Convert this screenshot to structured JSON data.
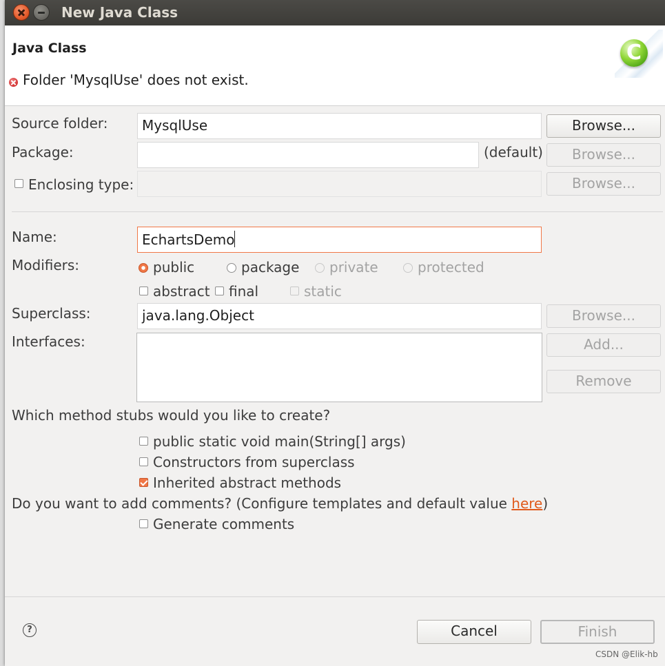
{
  "window": {
    "title": "New Java Class"
  },
  "header": {
    "title": "Java Class",
    "message": "Folder 'MysqlUse' does not exist."
  },
  "source_folder": {
    "label": "Source folder:",
    "value": "MysqlUse",
    "browse": "Browse..."
  },
  "package": {
    "label": "Package:",
    "value": "",
    "default_label": "(default)",
    "browse": "Browse..."
  },
  "enclosing": {
    "label": "Enclosing type:",
    "value": "",
    "browse": "Browse..."
  },
  "name": {
    "label": "Name:",
    "value": "EchartsDemo"
  },
  "modifiers": {
    "label": "Modifiers:",
    "public": "public",
    "package": "package",
    "private": "private",
    "protected": "protected",
    "abstract": "abstract",
    "final": "final",
    "static": "static"
  },
  "superclass": {
    "label": "Superclass:",
    "value": "java.lang.Object",
    "browse": "Browse..."
  },
  "interfaces": {
    "label": "Interfaces:",
    "add": "Add...",
    "remove": "Remove"
  },
  "stubs": {
    "question": "Which method stubs would you like to create?",
    "main": "public static void main(String[] args)",
    "constructors": "Constructors from superclass",
    "inherited": "Inherited abstract methods"
  },
  "comments": {
    "question_prefix": "Do you want to add comments? (Configure templates and default value ",
    "link": "here",
    "question_suffix": ")",
    "generate": "Generate comments"
  },
  "footer": {
    "help": "?",
    "cancel": "Cancel",
    "finish": "Finish"
  },
  "watermark": "CSDN @Elik-hb"
}
